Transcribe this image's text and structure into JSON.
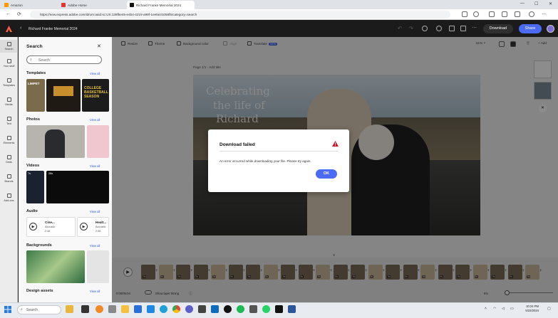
{
  "browser": {
    "tabs": [
      {
        "label": "Amazon",
        "active": false
      },
      {
        "label": "Adobe Home",
        "active": false
      },
      {
        "label": "Richard Franke Memorial 2024",
        "active": true
      }
    ],
    "url": "https://new.express.adobe.com/id/urn:aaid:sc:US:138f5e45-e4b4-4215-a99f-1ee5e31058f5/category=search"
  },
  "app": {
    "project_title": "Richard Franke Memorial 2024",
    "download_label": "Download",
    "share_label": "Share"
  },
  "rail": {
    "items": [
      {
        "label": "Search",
        "icon": "search-icon"
      },
      {
        "label": "Your stuff",
        "icon": "folder-icon"
      },
      {
        "label": "Templates",
        "icon": "templates-icon"
      },
      {
        "label": "Media",
        "icon": "media-icon"
      },
      {
        "label": "Text",
        "icon": "text-icon"
      },
      {
        "label": "Elements",
        "icon": "elements-icon"
      },
      {
        "label": "Grids",
        "icon": "grid-icon"
      },
      {
        "label": "Brands",
        "icon": "brand-icon"
      },
      {
        "label": "Add-ons",
        "icon": "addons-icon"
      }
    ]
  },
  "panel": {
    "title": "Search",
    "search_placeholder": "Search",
    "sections": {
      "templates": {
        "title": "Templates",
        "view_all": "View all"
      },
      "photos": {
        "title": "Photos",
        "view_all": "View all"
      },
      "videos": {
        "title": "Videos",
        "view_all": "View all",
        "durations": [
          "7s",
          "28s"
        ]
      },
      "audio": {
        "title": "Audio",
        "view_all": "View all",
        "tracks": [
          {
            "name": "Cine...",
            "artist": "Acoustic",
            "duration": "2:45"
          },
          {
            "name": "Healt...",
            "artist": "Acoustic",
            "duration": "2:06"
          }
        ]
      },
      "backgrounds": {
        "title": "Backgrounds",
        "view_all": "View all"
      },
      "design_assets": {
        "title": "Design assets",
        "view_all": "View all"
      }
    },
    "template_texts": [
      "LIMPET",
      "COLLEGE BASKETBALL SEASON"
    ]
  },
  "toolbar": {
    "resize": "Resize",
    "theme": "Theme",
    "background_color": "Background color",
    "align": "Align",
    "translate": "Translate",
    "new_badge": "NEW",
    "zoom": "51%",
    "add_label": "Add"
  },
  "canvas": {
    "page_label": "Page 1/1 - Add title",
    "design_text": [
      "Celebrating",
      "the life of",
      "Richard"
    ]
  },
  "dialog": {
    "title": "Download failed",
    "message": "An error occurred while downloading your file. Please try again.",
    "ok_label": "OK"
  },
  "timeline": {
    "time": "0:00/05:04",
    "show_layer_timing": "Show layer timing",
    "zoom_label": "5%",
    "clip_badges": [
      "5s",
      "5s",
      "5s",
      "5s",
      "5s",
      "5s",
      "5s",
      "5s",
      "5s",
      "5s",
      "5s",
      "5s",
      "5s",
      "5s",
      "5s",
      "5s",
      "5s",
      "5s",
      "5s",
      "5s",
      "5s",
      "5s",
      "5s"
    ]
  },
  "taskbar": {
    "search_placeholder": "Search",
    "time": "10:24 PM",
    "date": "5/23/2024"
  },
  "colors": {
    "accent": "#4b6bf5",
    "warning": "#d0142c"
  }
}
